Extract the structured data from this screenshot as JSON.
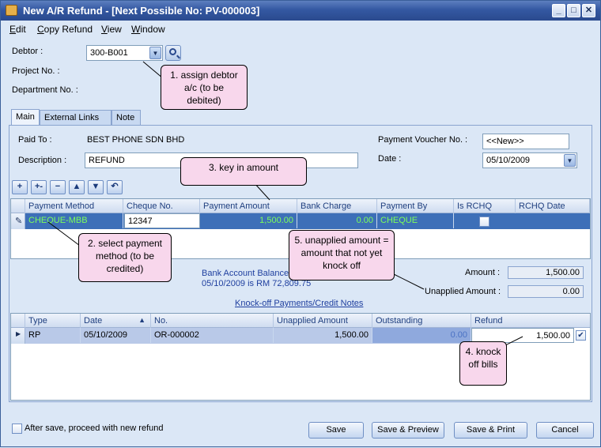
{
  "window": {
    "title": "New A/R Refund - [Next Possible No: PV-000003]"
  },
  "menu": [
    "Edit",
    "Copy Refund",
    "View",
    "Window"
  ],
  "header": {
    "debtor_label": "Debtor :",
    "debtor_value": "300-B001",
    "project_label": "Project No. :",
    "department_label": "Department No. :"
  },
  "tabs": [
    "Main",
    "External Links",
    "Note"
  ],
  "main": {
    "paid_to_label": "Paid To :",
    "paid_to_value": "BEST PHONE SDN BHD",
    "description_label": "Description :",
    "description_value": "REFUND",
    "voucher_label": "Payment Voucher No. :",
    "voucher_value": "<<New>>",
    "date_label": "Date :",
    "date_value": "05/10/2009"
  },
  "payment_grid": {
    "columns": [
      "Payment Method",
      "Cheque No.",
      "Payment Amount",
      "Bank Charge",
      "Payment By",
      "Is RCHQ",
      "RCHQ Date"
    ],
    "rows": [
      {
        "method": "CHEQUE-MBB",
        "cheque_no": "12347",
        "amount": "1,500.00",
        "bank_charge": "0.00",
        "payment_by": "CHEQUE",
        "rchq_date": ""
      }
    ]
  },
  "summary": {
    "bank_balance_line1": "Bank Account Balance",
    "bank_balance_line2": "05/10/2009 is RM 72,809.75",
    "amount_label": "Amount :",
    "amount_value": "1,500.00",
    "unapplied_label": "Unapplied Amount :",
    "unapplied_value": "0.00",
    "knockoff_link": "Knock-off Payments/Credit Notes"
  },
  "knockoff_grid": {
    "columns": [
      "Type",
      "Date",
      "No.",
      "Unapplied Amount",
      "Outstanding",
      "Refund"
    ],
    "rows": [
      {
        "type": "RP",
        "date": "05/10/2009",
        "no": "OR-000002",
        "unapplied": "1,500.00",
        "outstanding": "0.00",
        "refund": "1,500.00"
      }
    ]
  },
  "footer": {
    "after_save_label": "After save, proceed with new refund",
    "buttons": [
      "Save",
      "Save & Preview",
      "Save & Print",
      "Cancel"
    ]
  },
  "callouts": {
    "c1": "1. assign debtor a/c (to be debited)",
    "c2": "2. select payment method (to be credited)",
    "c3": "3. key in amount",
    "c4": "4. knock off bills",
    "c5": "5. unapplied amount = amount that not yet knock off"
  },
  "colors": {
    "title_bar": "#3458a2",
    "selected_row": "#3d6fb8",
    "callout": "#f8d7ec",
    "green_text": "#7cff5a"
  },
  "icons": [
    "app-icon",
    "minimize-icon",
    "maximize-icon",
    "close-icon",
    "dropdown-icon",
    "search-icon",
    "add-row-icon",
    "insert-row-icon",
    "delete-row-icon",
    "move-up-icon",
    "move-down-icon",
    "undo-icon",
    "sort-asc-icon",
    "edit-pencil-icon",
    "row-pointer-icon",
    "checkbox-icon"
  ]
}
